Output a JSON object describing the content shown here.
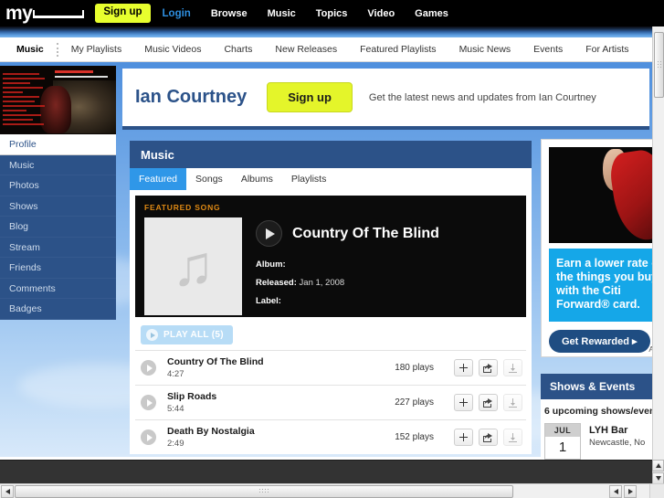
{
  "topbar": {
    "logo_text": "my",
    "signup_label": "Sign up",
    "login_label": "Login",
    "nav": [
      {
        "label": "Browse"
      },
      {
        "label": "Music"
      },
      {
        "label": "Topics"
      },
      {
        "label": "Video"
      },
      {
        "label": "Games"
      }
    ]
  },
  "subnav": {
    "active": "Music",
    "items": [
      {
        "label": "My Playlists"
      },
      {
        "label": "Music Videos"
      },
      {
        "label": "Charts"
      },
      {
        "label": "New Releases"
      },
      {
        "label": "Featured Playlists"
      },
      {
        "label": "Music News"
      },
      {
        "label": "Events"
      },
      {
        "label": "For Artists"
      }
    ]
  },
  "sidebar": {
    "items": [
      {
        "label": "Profile",
        "active": true
      },
      {
        "label": "Music",
        "active": false
      },
      {
        "label": "Photos",
        "active": false
      },
      {
        "label": "Shows",
        "active": false
      },
      {
        "label": "Blog",
        "active": false
      },
      {
        "label": "Stream",
        "active": false
      },
      {
        "label": "Friends",
        "active": false
      },
      {
        "label": "Comments",
        "active": false
      },
      {
        "label": "Badges",
        "active": false
      }
    ]
  },
  "artist_header": {
    "name": "Ian Courtney",
    "signup_label": "Sign up",
    "tagline": "Get the latest news and updates from Ian Courtney"
  },
  "music_module": {
    "title": "Music",
    "tabs": [
      {
        "label": "Featured",
        "active": true
      },
      {
        "label": "Songs",
        "active": false
      },
      {
        "label": "Albums",
        "active": false
      },
      {
        "label": "Playlists",
        "active": false
      }
    ],
    "featured": {
      "label": "FEATURED SONG",
      "song_title": "Country Of The Blind",
      "album_label": "Album:",
      "album_value": "",
      "released_label": "Released:",
      "released_value": "Jan 1, 2008",
      "label_label": "Label:",
      "label_value": ""
    },
    "play_all_label": "PLAY ALL (5)",
    "tracks": [
      {
        "title": "Country Of The Blind",
        "duration": "4:27",
        "plays": "180 plays"
      },
      {
        "title": "Slip Roads",
        "duration": "5:44",
        "plays": "227 plays"
      },
      {
        "title": "Death By Nostalgia",
        "duration": "2:49",
        "plays": "152 plays"
      }
    ]
  },
  "ad": {
    "headline": "Earn a lower rate on the things you buy with the Citi Forward® card.",
    "cta_label": "Get Rewarded ▸",
    "disclaimer": "Adv"
  },
  "shows": {
    "title": "Shows & Events",
    "subtitle": "6 upcoming shows/even",
    "events": [
      {
        "month": "JUL",
        "day": "1",
        "venue": "LYH Bar",
        "location": "Newcastle, No"
      }
    ]
  },
  "colors": {
    "brand_blue": "#2c5288",
    "accent_yellow": "#e4f52a",
    "tab_active_blue": "#2f97e8",
    "featured_orange": "#e08a14",
    "ad_blue": "#15a7e8"
  }
}
